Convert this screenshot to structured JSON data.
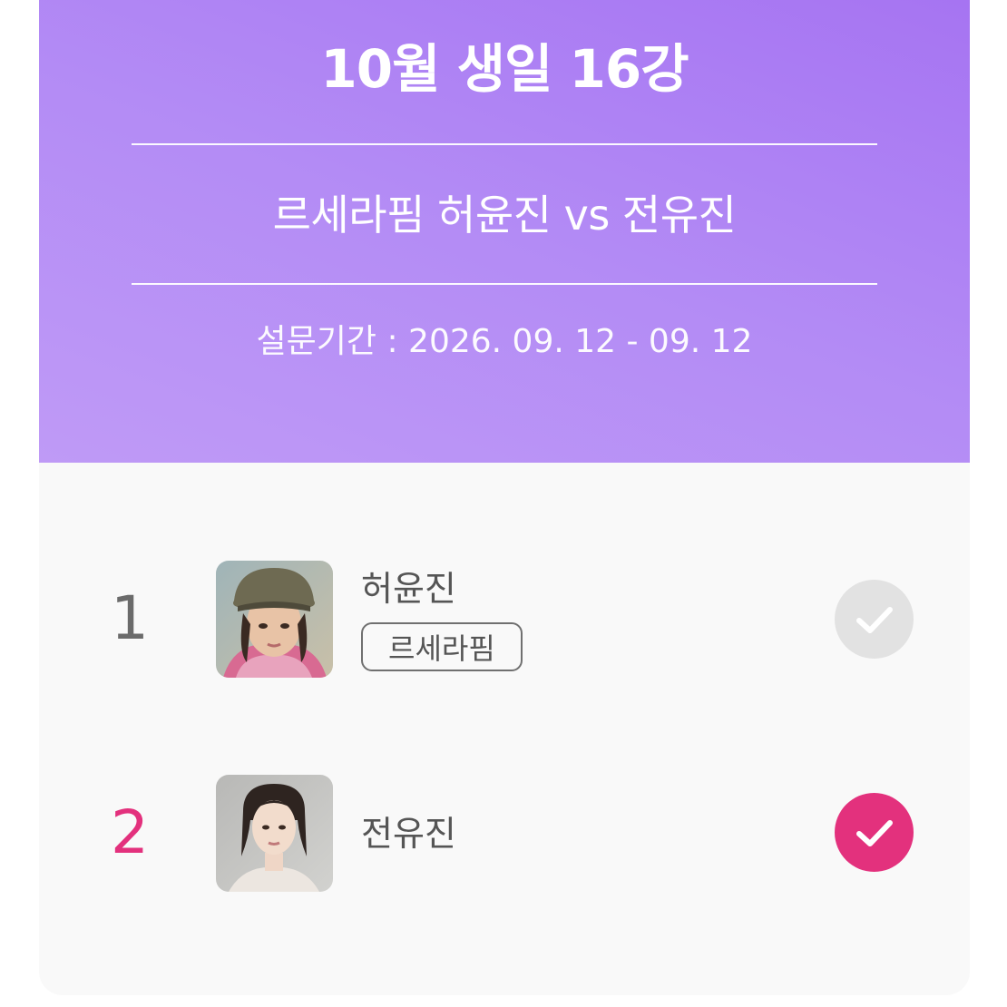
{
  "header": {
    "title": "10월 생일 16강",
    "matchup": "르세라핌 허윤진 vs 전유진",
    "period": "설문기간 : 2026. 09. 12 - 09. 12"
  },
  "results": [
    {
      "rank": "1",
      "name": "허윤진",
      "group": "르세라핌",
      "selected": false
    },
    {
      "rank": "2",
      "name": "전유진",
      "group": "",
      "selected": true
    }
  ],
  "colors": {
    "header_gradient": [
      "#a674f2",
      "#bf9af6"
    ],
    "accent_pink": "#e3317d",
    "unselected_check": "#e2e2e2",
    "card_bg": "#f9f9f9"
  },
  "icons": {
    "check": "checkmark-icon"
  }
}
